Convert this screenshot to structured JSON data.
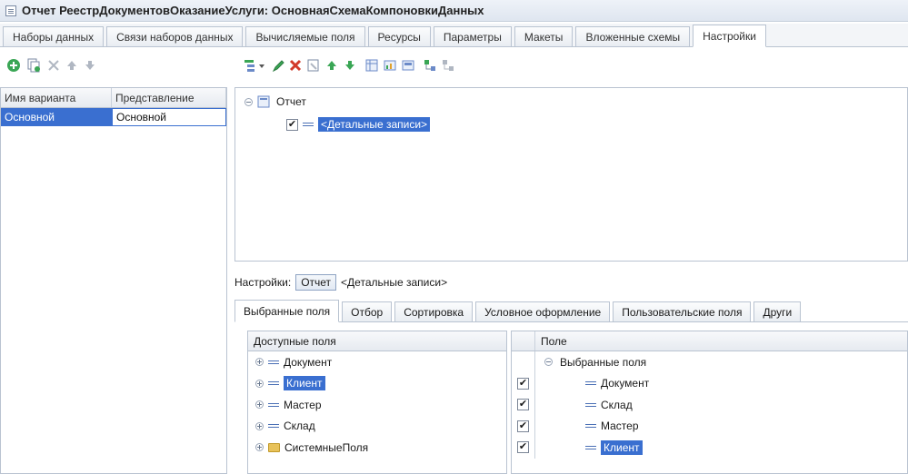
{
  "window": {
    "title": "Отчет РеестрДокументовОказаниеУслуги: ОсновнаяСхемаКомпоновкиДанных"
  },
  "tabs": [
    "Наборы данных",
    "Связи наборов данных",
    "Вычисляемые поля",
    "Ресурсы",
    "Параметры",
    "Макеты",
    "Вложенные схемы",
    "Настройки"
  ],
  "variants": {
    "columns": [
      "Имя варианта",
      "Представление"
    ],
    "rows": [
      {
        "name": "Основной",
        "presentation": "Основной"
      }
    ]
  },
  "structure": {
    "root": "Отчет",
    "child": "<Детальные записи>"
  },
  "settings": {
    "label": "Настройки:",
    "report_button": "Отчет",
    "detail_link": "<Детальные записи>"
  },
  "subtabs": [
    "Выбранные поля",
    "Отбор",
    "Сортировка",
    "Условное оформление",
    "Пользовательские поля",
    "Други"
  ],
  "available_fields": {
    "header": "Доступные поля",
    "items": [
      "Документ",
      "Клиент",
      "Мастер",
      "Склад",
      "СистемныеПоля"
    ]
  },
  "selected_fields": {
    "header": "Поле",
    "group": "Выбранные поля",
    "items": [
      "Документ",
      "Склад",
      "Мастер",
      "Клиент"
    ]
  },
  "icons": {
    "add": "add-icon",
    "copy": "copy-icon",
    "delete": "delete-icon",
    "up": "move-up-icon",
    "down": "move-down-icon",
    "edit": "edit-icon",
    "check": "check-icon",
    "report": "report-icon",
    "folder": "folder-icon"
  },
  "colors": {
    "selection": "#3a6fd0",
    "delete": "#d23a2a",
    "add": "#3aa655"
  }
}
